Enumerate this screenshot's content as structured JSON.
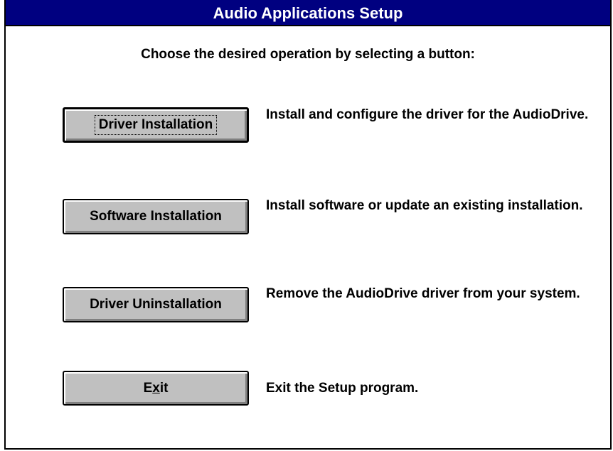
{
  "window": {
    "title": "Audio Applications Setup"
  },
  "instruction": "Choose the desired operation by selecting a button:",
  "options": [
    {
      "button_label": "Driver Installation",
      "description": "Install and configure the driver for the AudioDrive."
    },
    {
      "button_label": "Software Installation",
      "description": "Install software or update an existing installation."
    },
    {
      "button_label": "Driver Uninstallation",
      "description": "Remove the AudioDrive driver from your system."
    },
    {
      "button_label_before": "E",
      "button_label_mnemonic": "x",
      "button_label_after": "it",
      "description": "Exit the Setup program."
    }
  ],
  "colors": {
    "titlebar": "#000080",
    "button_face": "#c0c0c0",
    "background": "#ffffff"
  }
}
